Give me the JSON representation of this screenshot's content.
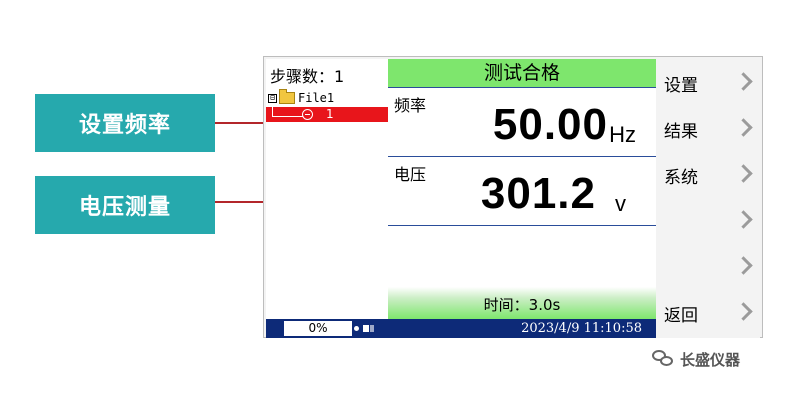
{
  "callouts": {
    "frequency": "设置频率",
    "voltage": "电压测量"
  },
  "left_panel": {
    "step_label": "步骤数：1",
    "tree_expand": "⊟",
    "file_name": "File1",
    "step_number": "1"
  },
  "header": {
    "result": "测试合格"
  },
  "measurements": {
    "frequency": {
      "label": "频率",
      "value": "50.00",
      "unit": "Hz"
    },
    "voltage": {
      "label": "电压",
      "value": "301.2",
      "unit": "v"
    }
  },
  "time_bar": {
    "text": "时间：3.0s"
  },
  "status_bar": {
    "progress": "0%",
    "datetime": "2023/4/9  11:10:58"
  },
  "menu": {
    "items": [
      {
        "label": "设置"
      },
      {
        "label": "结果"
      },
      {
        "label": "系统"
      },
      {
        "label": ""
      },
      {
        "label": ""
      },
      {
        "label": "返回"
      }
    ]
  },
  "watermark": {
    "brand": "长盛仪器"
  },
  "colors": {
    "callout_bg": "#26a9ad",
    "leader_line": "#b3262b",
    "pass_green": "#7ee66d",
    "selected_step": "#e8151b",
    "status_bar": "#0d2a78"
  }
}
